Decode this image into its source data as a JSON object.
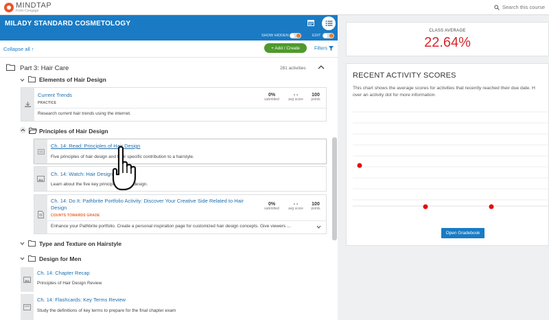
{
  "brand": {
    "name": "MINDTAP",
    "sub": "From Cengage"
  },
  "search": {
    "placeholder": "Search this course"
  },
  "course": {
    "title": "MILADY STANDARD COSMETOLOGY",
    "show_hidden": "SHOW HIDDEN",
    "edit": "EDIT"
  },
  "actions": {
    "collapse_all": "Collapse all",
    "add_create": "+ Add / Create",
    "filters": "Filters"
  },
  "part": {
    "title": "Part 3: Hair Care",
    "count": "281 activities"
  },
  "sections": {
    "elements": {
      "title": "Elements of Hair Design"
    },
    "principles": {
      "title": "Principles of Hair Design"
    },
    "texture": {
      "title": "Type and Texture on Hairstyle"
    },
    "design_men": {
      "title": "Design for Men"
    }
  },
  "cards": {
    "current_trends": {
      "title": "Current Trends",
      "type": "PRACTICE",
      "desc": "Research current hair trends using the internet.",
      "submitted": "0%",
      "submitted_lbl": "submitted",
      "avg": "- -",
      "avg_lbl": "avg score",
      "points": "100",
      "points_lbl": "points"
    },
    "read_principles": {
      "title": "Ch. 14: Read: Principles of Hair Design",
      "desc": "Five principles of hair design and their specific contribution to a hairstyle."
    },
    "watch_hair": {
      "title": "Ch. 14: Watch: Hair Design",
      "desc": "Learn about the five key principles of hair design."
    },
    "pathbrite": {
      "title_line1": "Ch. 14: Do It: Pathbrite Portfolio Activity: Discover Your Creative Side Related to Hair",
      "title_line2": "Design",
      "tag": "COUNTS TOWARDS GRADE",
      "desc": "Enhance your Pathbrite portfolio. Create a personal inspiration page for customized hair design concepts. Give viewers ...",
      "submitted": "0%",
      "submitted_lbl": "submitted",
      "avg": "- -",
      "avg_lbl": "avg score",
      "points": "100",
      "points_lbl": "points"
    },
    "chapter_recap": {
      "title": "Ch. 14: Chapter Recap",
      "desc": "Principles of Hair Design Review"
    },
    "flashcards": {
      "title": "Ch. 14: Flashcards: Key Terms Review",
      "desc": "Study the definitions of key terms to prepare for the final chapter exam"
    }
  },
  "class_average": {
    "label": "CLASS AVERAGE",
    "value": "22.64%"
  },
  "recent_scores": {
    "title": "RECENT ACTIVITY SCORES",
    "desc_line1": "This chart shows the average scores for activities that recently reached their due date. H",
    "desc_line2": "over an activity dot for more information.",
    "button": "Open Gradebook"
  },
  "colors": {
    "brand_blue": "#1a7bc4",
    "add_green": "#4e9a2c",
    "accent_red": "#d8262c",
    "grade_orange": "#e8632b"
  },
  "icons": [
    "search-icon",
    "calendar-icon",
    "list-icon",
    "folder-icon",
    "chevron-up-icon",
    "chevron-down-icon",
    "filter-icon",
    "document-icon",
    "image-icon",
    "pointer-hand-icon"
  ]
}
